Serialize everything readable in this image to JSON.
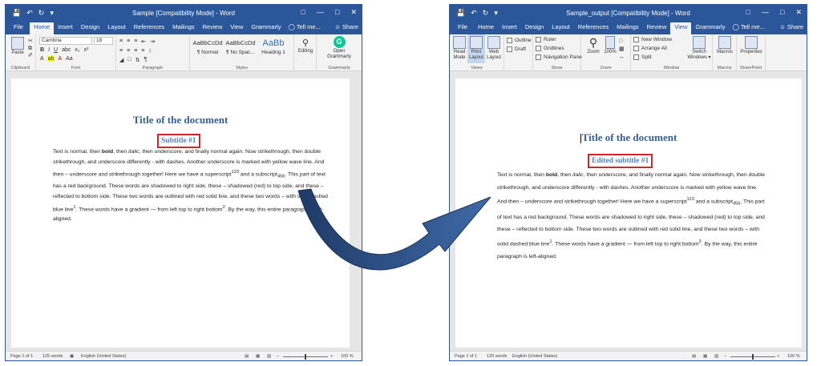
{
  "left": {
    "window_title": "Sample [Compatibility Mode] - Word",
    "tabs": [
      "File",
      "Home",
      "Insert",
      "Design",
      "Layout",
      "References",
      "Mailings",
      "Review",
      "View",
      "Grammarly"
    ],
    "tell_me": "Tell me...",
    "share": "Share",
    "ribbon": {
      "paste": "Paste",
      "clipboard": "Clipboard",
      "font_name": "Cambria",
      "font_size": "18",
      "font_group": "Font",
      "paragraph_group": "Paragraph",
      "style_1_preview": "AaBbCcDd",
      "style_1_name": "¶ Normal",
      "style_2_preview": "AaBbCcDd",
      "style_2_name": "¶ No Spac...",
      "style_3_preview": "AaBb",
      "style_3_name": "Heading 1",
      "styles_group": "Styles",
      "editing": "Editing",
      "open_grammarly_1": "Open",
      "open_grammarly_2": "Grammarly",
      "grammarly_group": "Grammarly"
    },
    "doc": {
      "title": "Title of the document",
      "subtitle": "Subtitle #1",
      "body_html": "Text is normal, then <b>bold</b>, then <i>italic</i>, then underscore, and finally normal again. Now strikethrough, then double strikethrough, and underscore differently - with dashes. Another underscore is marked with yellow wave line. And then – underscore and strikethrough together! Here we have a superscript<sup>123</sup> and a subscript<sub>456</sub>. This part of text has a red background. These words are shadowed to right side, these – shadowed (red) to top side, and these – reflected to bottom side. These two words are outlined with red solid line, and these two words – with solid dashed blue line<sup>1</sup>. These words have a gradient — from left top to right bottom<sup>2</sup>. By the way, this entire paragraph is left-aligned."
    },
    "status": {
      "page": "Page 1 of 1",
      "words": "125 words",
      "language": "English (United States)",
      "zoom": "100 %"
    }
  },
  "right": {
    "window_title": "Sample_output [Compatibility Mode] - Word",
    "tabs": [
      "File",
      "Home",
      "Insert",
      "Design",
      "Layout",
      "References",
      "Mailings",
      "Review",
      "View",
      "Grammarly"
    ],
    "tell_me": "Tell me...",
    "share": "Share",
    "ribbon": {
      "read_mode_1": "Read",
      "read_mode_2": "Mode",
      "print_layout_1": "Print",
      "print_layout_2": "Layout",
      "web_layout_1": "Web",
      "web_layout_2": "Layout",
      "views_group": "Views",
      "outline": "Outline",
      "draft": "Draft",
      "ruler": "Ruler",
      "gridlines": "Gridlines",
      "navigation_pane": "Navigation Pane",
      "show_group": "Show",
      "zoom": "Zoom",
      "zoom_100": "100%",
      "zoom_group": "Zoom",
      "new_window": "New Window",
      "arrange_all": "Arrange All",
      "split": "Split",
      "switch_windows_1": "Switch",
      "switch_windows_2": "Windows ▾",
      "window_group": "Window",
      "macros": "Macros",
      "macros_group": "Macros",
      "properties": "Properties",
      "sharepoint_group": "SharePoint"
    },
    "doc": {
      "title": "Title of the document",
      "subtitle": "Edited subtitle #1",
      "body_html": "Text is normal, then <b>bold</b>, then <i>italic</i>, then underscore, and finally normal again. Now strikethrough, then double strikethrough, and underscore differently - with dashes. Another underscore is marked with yellow wave line. And then – underscore and strikethrough together! Here we have a superscript<sup>123</sup> and a subscript<sub>456</sub>. This part of text has a red background. These words are shadowed to right side, these – shadowed (red) to top side, and these – reflected to bottom side. These two words are outlined with red solid line, and these two words – with solid dashed blue line<sup>1</sup>. These words have a gradient — from left top to right bottom<sup>2</sup>. By the way, this entire paragraph is left-aligned."
    },
    "status": {
      "page": "Page 1 of 1",
      "words": "126 words",
      "language": "English (United States)",
      "zoom": "100 %"
    }
  },
  "colors": {
    "word_blue": "#2b579a",
    "highlight_red": "#d0252b",
    "arrow_blue": "#2e4f7f",
    "title_blue": "#365f91",
    "subtitle_blue": "#4f81bd"
  }
}
